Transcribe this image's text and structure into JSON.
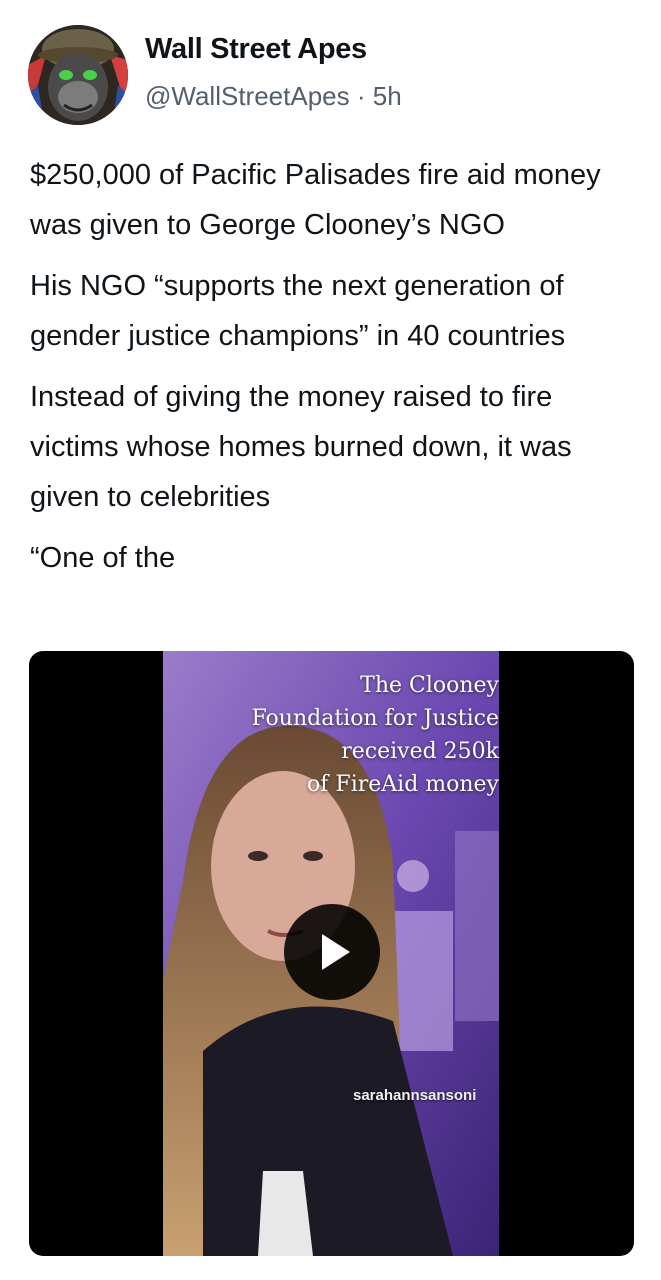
{
  "author": {
    "display_name": "Wall Street Apes",
    "handle": "@WallStreetApes",
    "separator": "·",
    "time_ago": "5h"
  },
  "tweet": {
    "paragraphs": [
      "$250,000 of Pacific Palisades fire aid money was given to George Clooney’s NGO",
      "His NGO “supports the next generation of gender justice champions” in 40 countries",
      "Instead of giving the money raised to fire victims whose homes burned down, it was given to celebrities",
      "“One of the"
    ]
  },
  "media": {
    "caption_lines": [
      "The Clooney",
      "Foundation for Justice",
      "received 250k",
      "of FireAid money"
    ],
    "watermark": "sarahannsansoni",
    "play_icon": "play-icon"
  },
  "colors": {
    "text": "#0f1419",
    "secondary_text": "#555f6a",
    "media_bg": "#000000",
    "room_purple": "#7a52b8"
  }
}
